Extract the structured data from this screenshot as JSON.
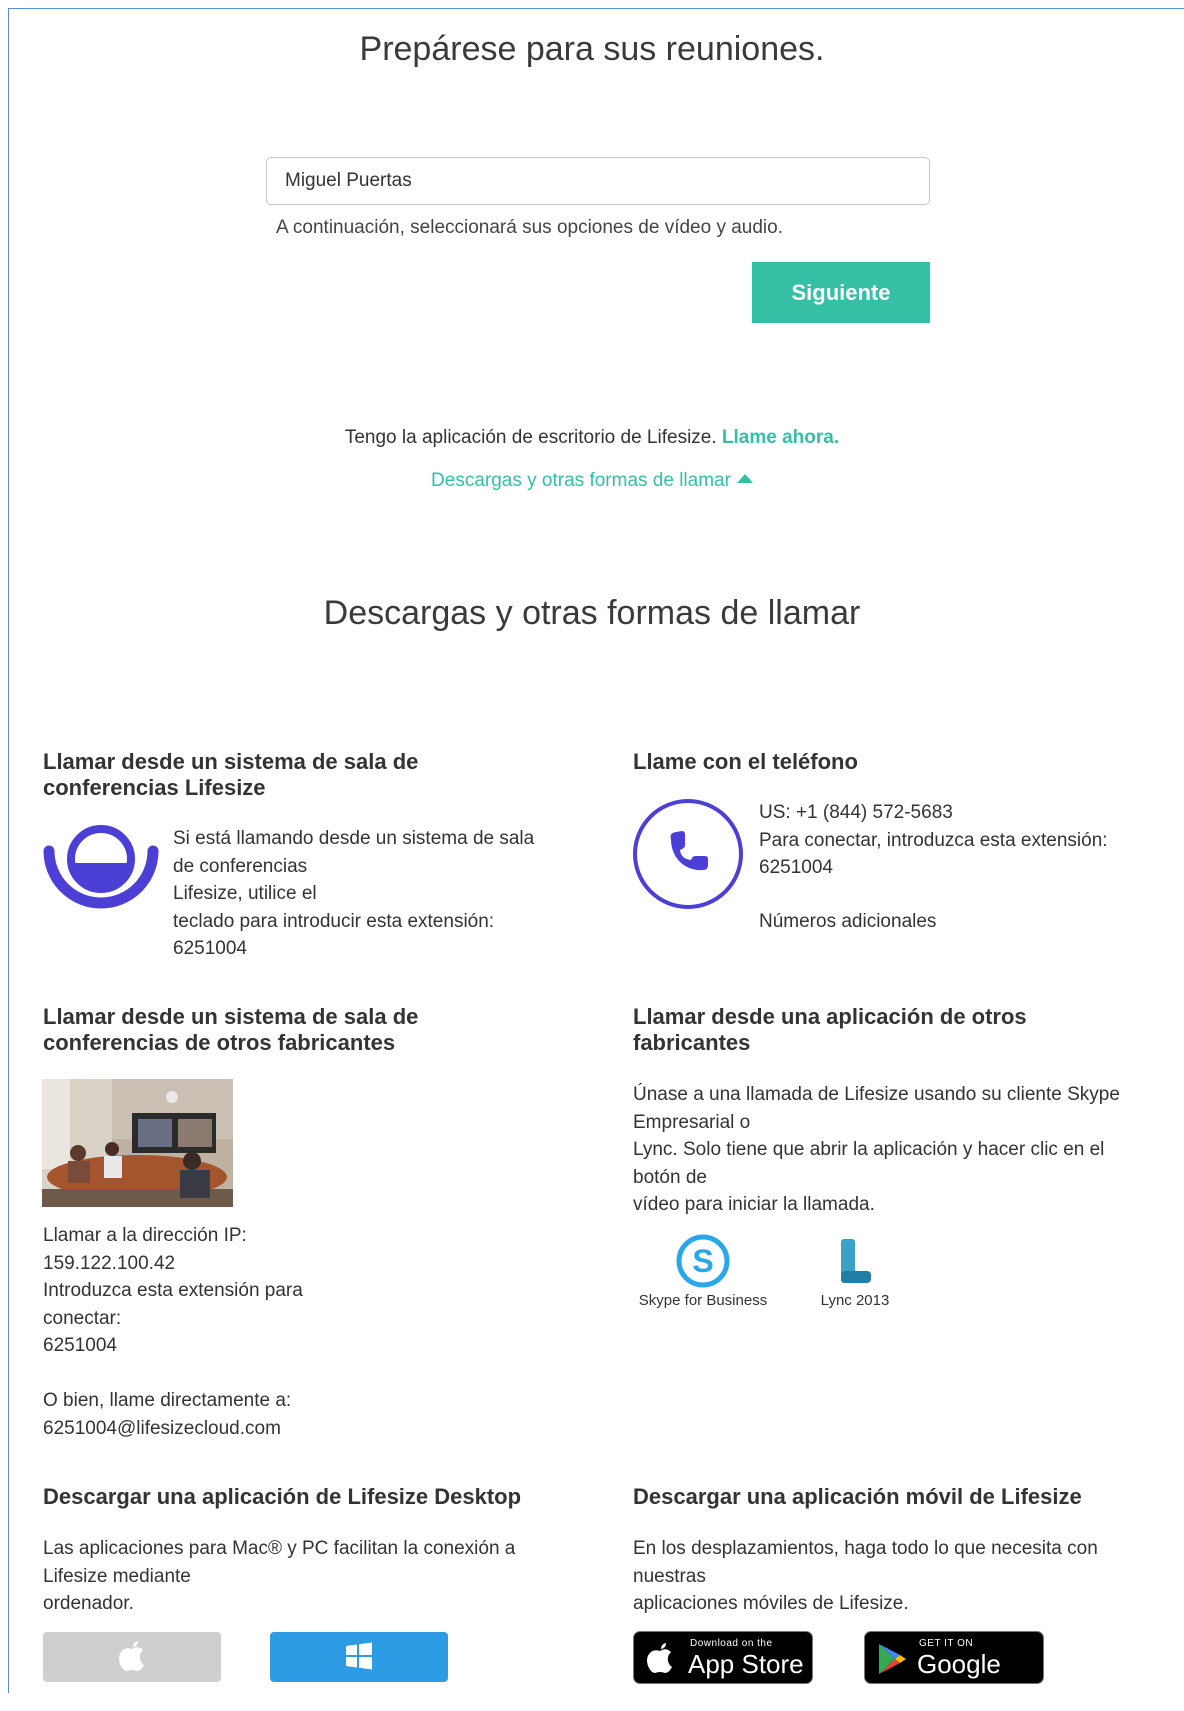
{
  "header": {
    "title": "Prepárese para sus reuniones."
  },
  "form": {
    "name_value": "Miguel Puertas",
    "hint": "A continuación, seleccionará sus opciones de vídeo y audio.",
    "next_label": "Siguiente"
  },
  "desktop_app": {
    "text": "Tengo la aplicación de escritorio de Lifesize. ",
    "link": "Llame ahora."
  },
  "downloads_toggle": {
    "label": "Descargas y otras formas de llamar"
  },
  "section": {
    "title": "Descargas y otras formas de llamar"
  },
  "lifesize_room": {
    "heading_1": "Llamar desde un sistema de sala de",
    "heading_2": "conferencias Lifesize",
    "lines": [
      "Si está llamando desde un sistema de sala",
      "de conferencias",
      "Lifesize, utilice el",
      "teclado para introducir esta extensión:",
      "6251004"
    ]
  },
  "phone": {
    "heading": "Llame con el teléfono",
    "lines": [
      "US: +1 (844) 572-5683",
      "Para conectar, introduzca esta extensión:",
      "6251004"
    ],
    "more_link": "Números adicionales"
  },
  "other_room": {
    "heading_1": "Llamar desde un sistema de sala de",
    "heading_2": "conferencias de otros fabricantes",
    "lines": [
      "Llamar a la dirección IP:",
      "159.122.100.42",
      "Introduzca esta extensión para",
      "conectar:",
      "6251004"
    ],
    "lines2": [
      "O bien, llame directamente a:",
      "6251004@lifesizecloud.com"
    ]
  },
  "other_app": {
    "heading_1": "Llamar desde una aplicación de otros",
    "heading_2": "fabricantes",
    "lines": [
      "Únase a una llamada de Lifesize usando su cliente Skype",
      "Empresarial o",
      "Lync. Solo tiene que abrir la aplicación y hacer clic en el",
      "botón de",
      "vídeo para iniciar la llamada."
    ],
    "skype_label": "Skype for Business",
    "lync_label": "Lync 2013"
  },
  "desktop_download": {
    "heading": "Descargar una aplicación de Lifesize Desktop",
    "lines": [
      "Las aplicaciones para Mac® y PC facilitan la conexión a",
      "Lifesize mediante",
      "ordenador."
    ]
  },
  "mobile_download": {
    "heading": "Descargar una aplicación móvil de Lifesize",
    "lines": [
      "En los desplazamientos, haga todo lo que necesita con",
      "nuestras",
      "aplicaciones móviles de Lifesize."
    ],
    "appstore_small": "Download on the",
    "appstore_big": "App Store",
    "googleplay_small": "GET IT ON",
    "googleplay_big": "Google Play"
  },
  "colors": {
    "accent": "#35bfa5",
    "lifesize_purple": "#4b3fd6",
    "windows_blue": "#2e9be5",
    "mac_gray": "#cfcfcf"
  }
}
